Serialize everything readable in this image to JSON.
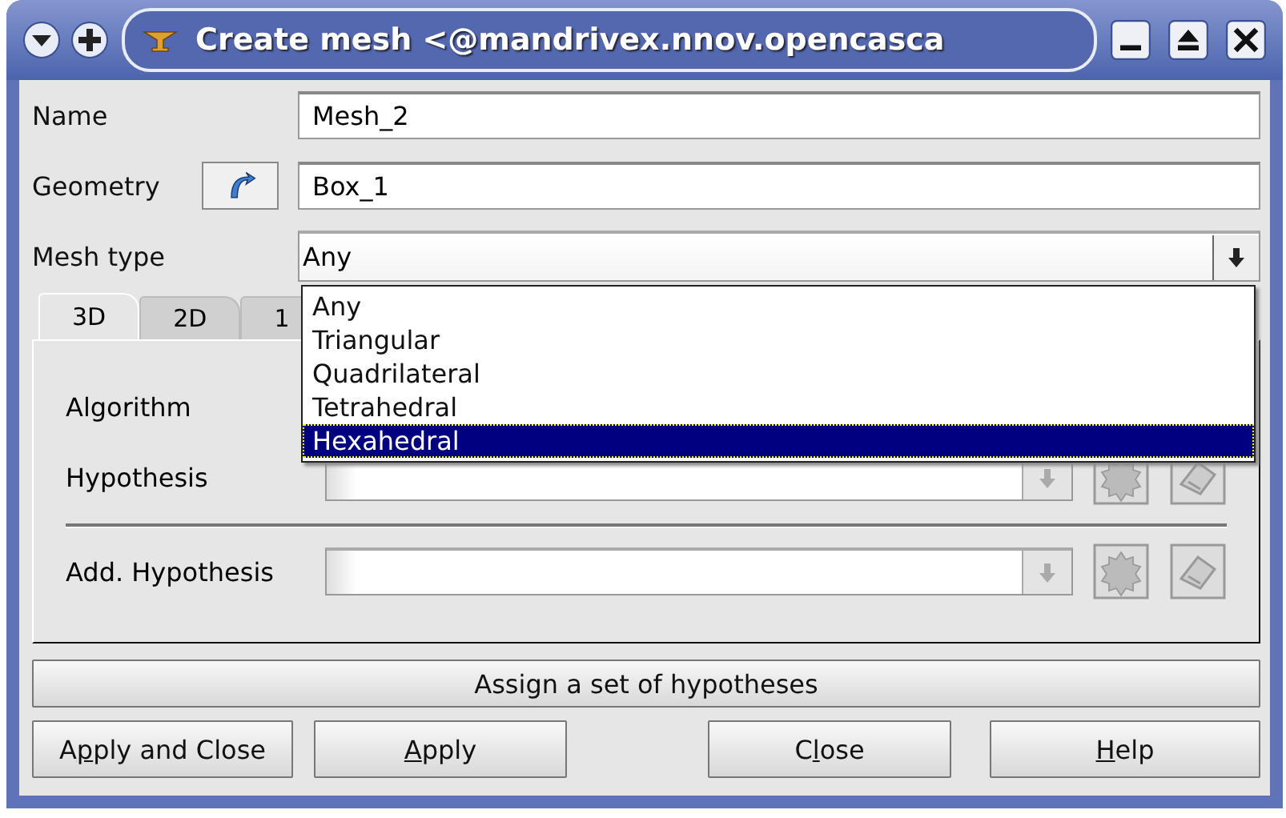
{
  "window": {
    "title": "Create mesh <@mandrivex.nnov.opencasca"
  },
  "fields": [
    {
      "kind": "text",
      "label": "Name",
      "value": "Mesh_2"
    },
    {
      "kind": "geometry",
      "label": "Geometry",
      "value": "Box_1"
    },
    {
      "kind": "combo",
      "label": "Mesh type",
      "value": "Any",
      "expanded": true
    }
  ],
  "dropdown": {
    "items": [
      {
        "label": "Any",
        "selected": false
      },
      {
        "label": "Triangular",
        "selected": false
      },
      {
        "label": "Quadrilateral",
        "selected": false
      },
      {
        "label": "Tetrahedral",
        "selected": false
      },
      {
        "label": "Hexahedral",
        "selected": true
      }
    ]
  },
  "tabs": [
    {
      "label": "3D",
      "selected": true
    },
    {
      "label": "2D",
      "selected": false
    },
    {
      "label": "1",
      "selected": false
    }
  ],
  "panel_rows": [
    {
      "kind": "label",
      "label": "Algorithm"
    },
    {
      "kind": "combo",
      "label": "Hypothesis"
    },
    {
      "kind": "separator"
    },
    {
      "kind": "combo",
      "label": "Add. Hypothesis"
    }
  ],
  "assign_button": {
    "label": "Assign a set of hypotheses"
  },
  "buttons": [
    {
      "pre": "A",
      "key": "p",
      "post": "ply and Close"
    },
    {
      "key": "A",
      "post": "pply"
    },
    {
      "pre": "C",
      "key": "l",
      "post": "ose"
    },
    {
      "key": "H",
      "post": "elp"
    }
  ]
}
